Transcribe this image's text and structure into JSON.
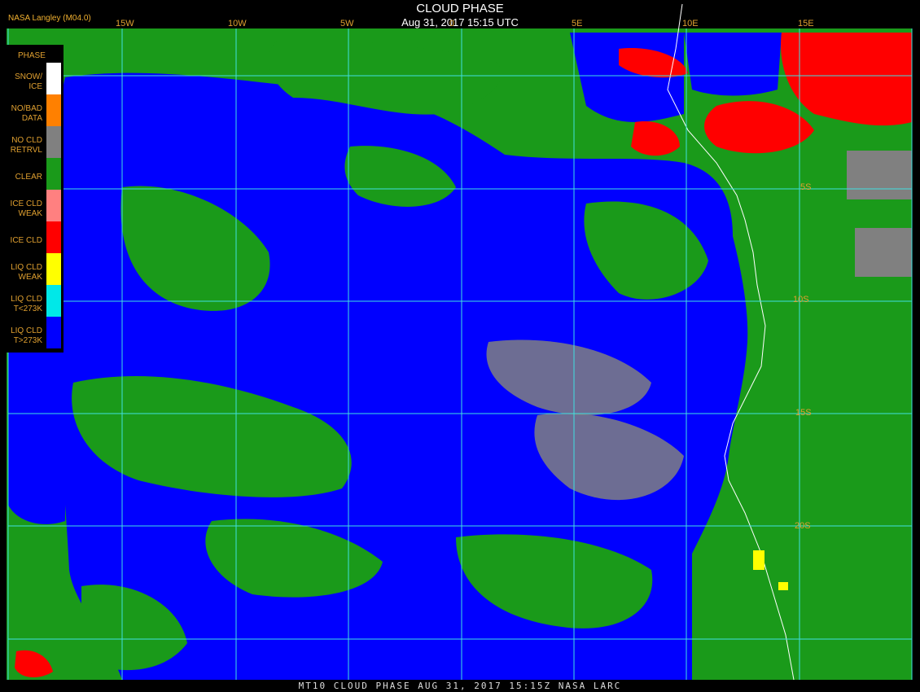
{
  "header": {
    "title": "CLOUD PHASE",
    "subtitle": "Aug 31, 2017 15:15 UTC",
    "source": "NASA Langley (M04.0)"
  },
  "footer": {
    "text": "MT10  CLOUD PHASE   AUG 31, 2017 15:15Z   NASA LARC"
  },
  "legend": {
    "title": "PHASE",
    "items": [
      {
        "label_1": "SNOW/",
        "label_2": "ICE",
        "color": "#ffffff"
      },
      {
        "label_1": "NO/BAD",
        "label_2": "DATA",
        "color": "#ff8000"
      },
      {
        "label_1": "NO CLD",
        "label_2": "RETRVL",
        "color": "#808080"
      },
      {
        "label_1": "CLEAR",
        "label_2": "",
        "color": "#1a9a1a"
      },
      {
        "label_1": "ICE CLD",
        "label_2": "WEAK",
        "color": "#ff8080"
      },
      {
        "label_1": "ICE CLD",
        "label_2": "",
        "color": "#ff0000"
      },
      {
        "label_1": "LIQ CLD",
        "label_2": "WEAK",
        "color": "#ffff00"
      },
      {
        "label_1": "LIQ CLD",
        "label_2": "T<273K",
        "color": "#00e8e8"
      },
      {
        "label_1": "LIQ CLD",
        "label_2": "T>273K",
        "color": "#0000ff"
      }
    ]
  },
  "grid": {
    "longitude_labels": [
      "15W",
      "10W",
      "5W",
      "0",
      "5E",
      "10E",
      "15E"
    ],
    "latitude_labels": [
      "5S",
      "10S",
      "15S",
      "20S"
    ],
    "color": "#40e0e0"
  },
  "colors": {
    "ocean_cloud": "#0000ff",
    "clear": "#1a9a1a",
    "ice": "#ff0000",
    "no_retrieval": "#808080",
    "coast": "#ffffff"
  }
}
